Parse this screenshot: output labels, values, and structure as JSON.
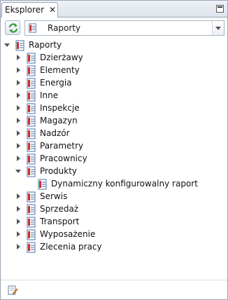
{
  "tab": {
    "title": "Eksplorer",
    "close_glyph": "✕"
  },
  "toolbar": {
    "refresh_icon": "refresh-icon",
    "combo_value": "Raporty",
    "combo_icon": "report-icon"
  },
  "tree": {
    "root": {
      "label": "Raporty",
      "expanded": true
    },
    "items": [
      {
        "label": "Dzierżawy",
        "expanded": false,
        "children": []
      },
      {
        "label": "Elementy",
        "expanded": false,
        "children": []
      },
      {
        "label": "Energia",
        "expanded": false,
        "children": []
      },
      {
        "label": "Inne",
        "expanded": false,
        "children": []
      },
      {
        "label": "Inspekcje",
        "expanded": false,
        "children": []
      },
      {
        "label": "Magazyn",
        "expanded": false,
        "children": []
      },
      {
        "label": "Nadzór",
        "expanded": false,
        "children": []
      },
      {
        "label": "Parametry",
        "expanded": false,
        "children": []
      },
      {
        "label": "Pracownicy",
        "expanded": false,
        "children": []
      },
      {
        "label": "Produkty",
        "expanded": true,
        "children": [
          {
            "label": "Dynamiczny konfigurowalny raport"
          }
        ]
      },
      {
        "label": "Serwis",
        "expanded": false,
        "children": []
      },
      {
        "label": "Sprzedaż",
        "expanded": false,
        "children": []
      },
      {
        "label": "Transport",
        "expanded": false,
        "children": []
      },
      {
        "label": "Wyposażenie",
        "expanded": false,
        "children": []
      },
      {
        "label": "Zlecenia pracy",
        "expanded": false,
        "children": []
      }
    ]
  },
  "footer": {
    "icon": "edit-report-icon"
  },
  "colors": {
    "border": "#9aa6b4",
    "icon_red": "#c8312b",
    "icon_blue": "#4a6fa5",
    "refresh_green": "#3a9a3a"
  }
}
